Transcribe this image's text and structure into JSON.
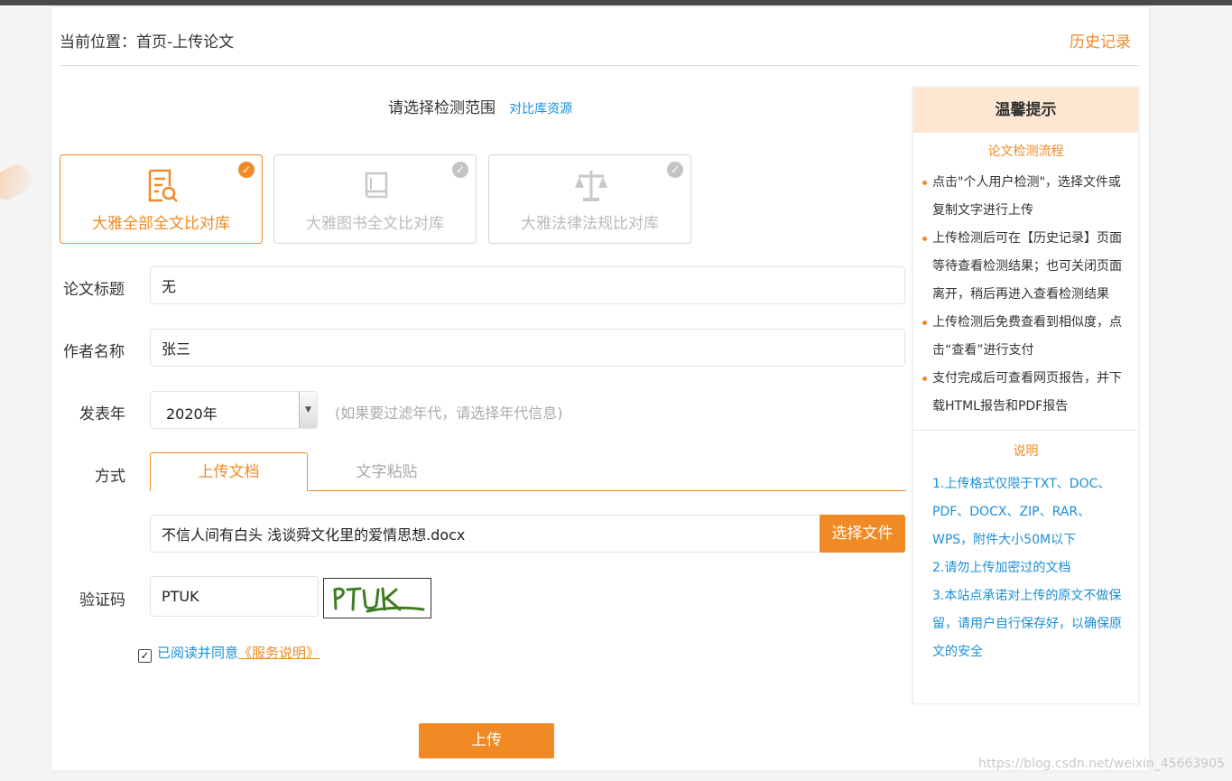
{
  "breadcrumb": "当前位置：首页-上传论文",
  "history_link": "历史记录",
  "scope": {
    "title": "请选择检测范围",
    "link": "对比库资源"
  },
  "libraries": [
    {
      "label": "大雅全部全文比对库",
      "selected": true,
      "icon": "document-search-icon"
    },
    {
      "label": "大雅图书全文比对库",
      "selected": true,
      "icon": "book-icon"
    },
    {
      "label": "大雅法律法规比对库",
      "selected": true,
      "icon": "scale-icon"
    }
  ],
  "form": {
    "title_label": "论文标题",
    "title_value": "无",
    "author_label": "作者名称",
    "author_value": "张三",
    "year_label": "发表年",
    "year_value": "2020年",
    "year_hint": "(如果要过滤年代，请选择年代信息)",
    "method_label": "方式",
    "tabs": [
      "上传文档",
      "文字粘贴"
    ],
    "active_tab": "上传文档",
    "file_value": "不信人间有白头 浅谈舜文化里的爱情思想.docx",
    "file_button": "选择文件",
    "captcha_label": "验证码",
    "captcha_value": "PTUK",
    "captcha_image_text": "PTUK",
    "agree_checked": true,
    "agree_text": "已阅读并同意",
    "agree_link": "《服务说明》",
    "submit": "上传"
  },
  "tips": {
    "title": "温馨提示",
    "process_title": "论文检测流程",
    "process": [
      "点击\"个人用户检测\"，选择文件或复制文字进行上传",
      "上传检测后可在【历史记录】页面等待查看检测结果；也可关闭页面离开，稍后再进入查看检测结果",
      "上传检测后免费查看到相似度，点击“查看”进行支付",
      "支付完成后可查看网页报告，并下载HTML报告和PDF报告"
    ],
    "notes_title": "说明",
    "notes": [
      "1.上传格式仅限于TXT、DOC、PDF、DOCX、ZIP、RAR、WPS，附件大小50M以下",
      "2.请勿上传加密过的文档",
      "3.本站点承诺对上传的原文不做保留，请用户自行保存好，以确保原文的安全"
    ]
  },
  "watermark": "https://blog.csdn.net/weixin_45663905",
  "colors": {
    "accent": "#f08a24",
    "link": "#1a8fd6",
    "tips_header_bg": "#fde7d2"
  }
}
